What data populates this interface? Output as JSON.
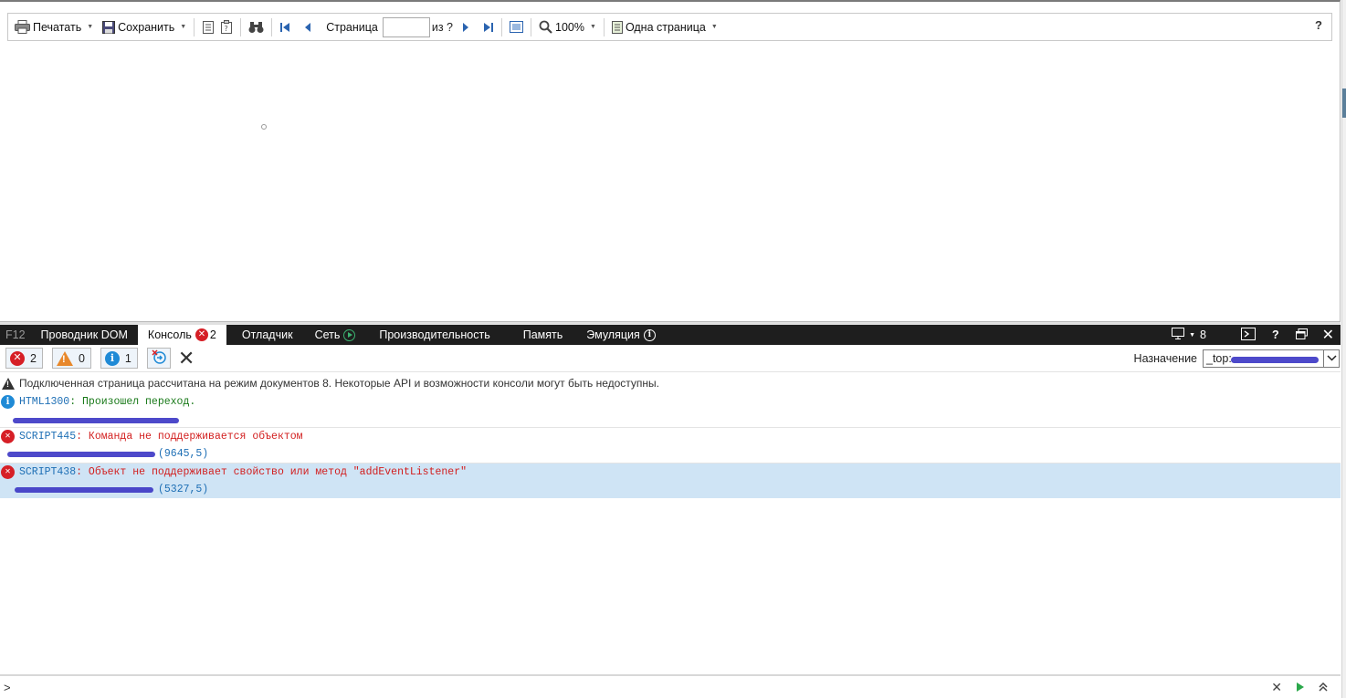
{
  "viewer": {
    "toolbar": {
      "print_label": "Печатать",
      "save_label": "Сохранить",
      "page_label": "Страница",
      "page_value": "",
      "of_label": "из ?",
      "zoom_label": "100%",
      "view_mode_label": "Одна страница",
      "help_label": "?"
    }
  },
  "devtools": {
    "tabs": {
      "f12": "F12",
      "dom": "Проводник DOM",
      "console": "Консоль",
      "console_count": "2",
      "debugger": "Отладчик",
      "network": "Сеть",
      "performance": "Производительность",
      "memory": "Память",
      "emulation": "Эмуляция",
      "doc_mode": "8",
      "help": "?"
    },
    "filters": {
      "errors": "2",
      "warnings": "0",
      "info": "1"
    },
    "target": {
      "label": "Назначение",
      "value": "_top: "
    },
    "messages": {
      "doc_mode_notice": "Подключенная страница рассчитана на режим документов 8. Некоторые API и возможности консоли могут быть недоступны.",
      "m1": {
        "code": "HTML1300",
        "text": ": Произошел переход."
      },
      "m2": {
        "code": "SCRIPT445",
        "text": ": Команда не поддерживается объектом",
        "location": "(9645,5)"
      },
      "m3": {
        "code": "SCRIPT438",
        "text": ": Объект не поддерживает свойство или метод \"addEventListener\"",
        "location": "(5327,5)"
      }
    },
    "input": {
      "prompt": ">"
    }
  },
  "colors": {
    "error": "#d61f26",
    "warning": "#e8882b",
    "info": "#1f8ad6",
    "tabbar": "#1e1e1e",
    "selected_row": "#cfe4f5"
  },
  "icons": [
    "printer-icon",
    "floppy-save-icon",
    "document-map-icon",
    "parameters-icon",
    "binoculars-find-icon",
    "first-page-icon",
    "previous-page-icon",
    "next-page-icon",
    "last-page-icon",
    "page-layout-icon",
    "zoom-icon",
    "single-page-icon",
    "error-icon",
    "warning-icon",
    "info-icon",
    "clear-icon",
    "screen-icon",
    "console-icon",
    "undock-icon",
    "close-icon",
    "run-icon",
    "expand-icon"
  ]
}
